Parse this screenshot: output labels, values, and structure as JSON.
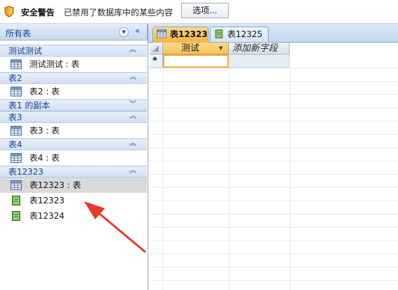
{
  "security_bar": {
    "title": "安全警告",
    "message": "已禁用了数据库中的某些内容",
    "options_button": "选项..."
  },
  "nav_pane": {
    "title": "所有表",
    "groups": [
      {
        "label": "测试测试",
        "state": "expanded",
        "items": [
          {
            "label": "测试测试 : 表",
            "icon": "table-icon"
          }
        ]
      },
      {
        "label": "表2",
        "state": "expanded",
        "items": [
          {
            "label": "表2 : 表",
            "icon": "table-icon"
          }
        ]
      },
      {
        "label": "表1 的副本",
        "state": "collapsed",
        "items": []
      },
      {
        "label": "表3",
        "state": "expanded",
        "items": [
          {
            "label": "表3 : 表",
            "icon": "table-icon"
          }
        ]
      },
      {
        "label": "表4",
        "state": "expanded",
        "items": [
          {
            "label": "表4 : 表",
            "icon": "table-icon"
          }
        ]
      },
      {
        "label": "表12323",
        "state": "expanded",
        "items": [
          {
            "label": "表12323 : 表",
            "icon": "table-icon",
            "selected": true
          },
          {
            "label": "表12323",
            "icon": "form-icon"
          },
          {
            "label": "表12324",
            "icon": "form-icon"
          }
        ]
      }
    ]
  },
  "tabs": [
    {
      "label": "表12323",
      "icon": "table-icon",
      "active": true
    },
    {
      "label": "表12325",
      "icon": "form-icon",
      "active": false
    }
  ],
  "datasheet": {
    "columns": [
      "测试",
      "添加新字段"
    ],
    "new_row_marker": "*"
  },
  "colors": {
    "accent": "#f7b440",
    "annotation": "#e8392f"
  }
}
